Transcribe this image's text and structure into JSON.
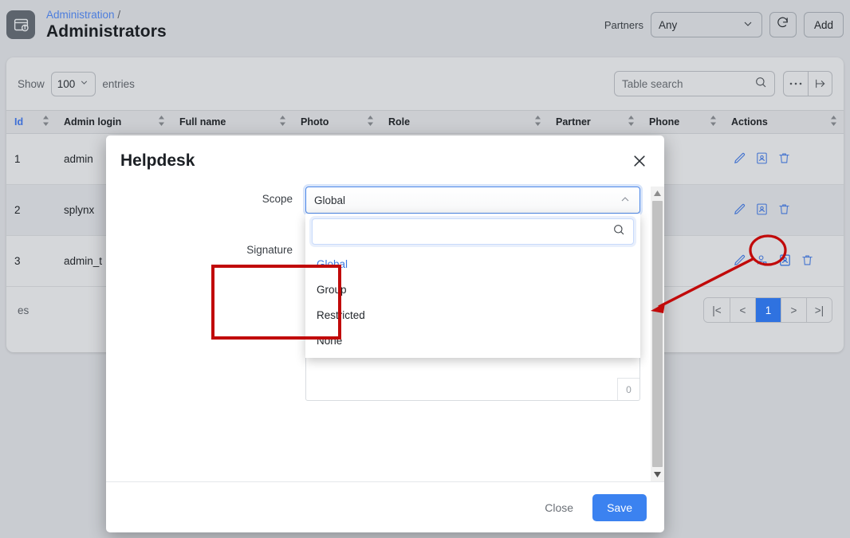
{
  "header": {
    "breadcrumb_link": "Administration",
    "breadcrumb_separator": "/",
    "title": "Administrators",
    "app_icon": "card-info-icon",
    "partners_label": "Partners",
    "partners_value": "Any",
    "refresh_icon": "refresh-icon",
    "add_label": "Add"
  },
  "toolbar": {
    "show_label": "Show",
    "entries_value": "100",
    "entries_label": "entries",
    "search_placeholder": "Table search",
    "search_value": "",
    "search_icon": "search-icon",
    "more_icon": "ellipsis-icon",
    "export_icon": "arrow-to-right-icon"
  },
  "table": {
    "columns": [
      {
        "label": "Id",
        "sortable": true
      },
      {
        "label": "Admin login",
        "sortable": true
      },
      {
        "label": "Full name",
        "sortable": true
      },
      {
        "label": "Photo",
        "sortable": true
      },
      {
        "label": "Role",
        "sortable": true
      },
      {
        "label": "Partner",
        "sortable": true
      },
      {
        "label": "Phone",
        "sortable": true
      },
      {
        "label": "Actions",
        "sortable": true
      }
    ],
    "rows": [
      {
        "id": "1",
        "admin_login": "admin",
        "full_name": "",
        "photo": "",
        "role": "",
        "partner": "",
        "phone": "",
        "actions": [
          "edit-icon",
          "card-account-icon",
          "delete-icon"
        ]
      },
      {
        "id": "2",
        "admin_login": "splynx",
        "full_name": "",
        "photo": "",
        "role": "",
        "partner": "",
        "phone": "",
        "actions": [
          "edit-icon",
          "card-account-icon",
          "delete-icon"
        ]
      },
      {
        "id": "3",
        "admin_login": "admin_t",
        "full_name": "",
        "photo": "",
        "role": "",
        "partner": "",
        "phone": "",
        "actions": [
          "edit-icon",
          "user-add-icon",
          "card-account-icon",
          "delete-icon"
        ]
      }
    ]
  },
  "footer": {
    "info_text": "es",
    "pager": {
      "first": "|<",
      "prev": "<",
      "pages": [
        "1"
      ],
      "next": ">",
      "last": ">|",
      "current": "1"
    }
  },
  "modal": {
    "title": "Helpdesk",
    "close_icon": "close-icon",
    "scope": {
      "label": "Scope",
      "value": "Global",
      "chevron_icon": "chevron-up-icon",
      "dropdown_search_value": "",
      "dropdown_search_icon": "search-icon",
      "options": [
        {
          "label": "Global",
          "selected": true
        },
        {
          "label": "Group",
          "selected": false
        },
        {
          "label": "Restricted",
          "selected": false
        },
        {
          "label": "None",
          "selected": false
        }
      ]
    },
    "signature": {
      "label": "Signature",
      "value": "",
      "char_count": "0"
    },
    "close_label": "Close",
    "save_label": "Save"
  },
  "annotations": {
    "highlight_box_color": "#c10a0a",
    "circle_target": "card-account-icon",
    "arrow_color": "#c10a0a"
  },
  "colors": {
    "accent_blue": "#3b82f0",
    "link_blue": "#4c7ddd",
    "page_bg": "#c9ccd1",
    "card_bg": "#d5d7da",
    "annotation_red": "#c10a0a"
  }
}
